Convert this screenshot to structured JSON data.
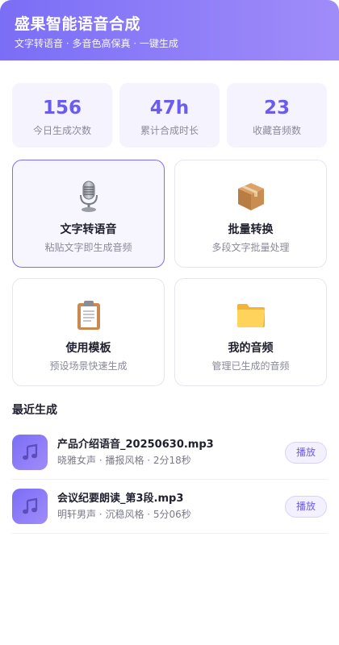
{
  "header": {
    "title": "盛果智能语音合成",
    "subtitle": "文字转语音 · 多音色高保真 · 一键生成"
  },
  "stats": [
    {
      "value": "156",
      "label": "今日生成次数"
    },
    {
      "value": "47h",
      "label": "累计合成时长"
    },
    {
      "value": "23",
      "label": "收藏音频数"
    }
  ],
  "features": [
    {
      "icon": "microphone-icon",
      "title": "文字转语音",
      "desc": "粘贴文字即生成音频",
      "active": true
    },
    {
      "icon": "package-box-icon",
      "title": "批量转换",
      "desc": "多段文字批量处理",
      "active": false
    },
    {
      "icon": "clipboard-icon",
      "title": "使用模板",
      "desc": "预设场景快速生成",
      "active": false
    },
    {
      "icon": "folder-icon",
      "title": "我的音频",
      "desc": "管理已生成的音频",
      "active": false
    }
  ],
  "recent": {
    "title": "最近生成",
    "items": [
      {
        "icon": "music-note-icon",
        "name": "产品介绍语音_20250630.mp3",
        "meta": "晓雅女声 · 播报风格 · 2分18秒",
        "action": "播放"
      },
      {
        "icon": "music-note-icon",
        "name": "会议纪要朗读_第3段.mp3",
        "meta": "明轩男声 · 沉稳风格 · 5分06秒",
        "action": "播放"
      }
    ]
  },
  "colors": {
    "accent": "#6a5cf0",
    "header_start": "#7b6ef6",
    "header_end": "#a08cf9",
    "stat_bg": "#f5f3fe"
  }
}
